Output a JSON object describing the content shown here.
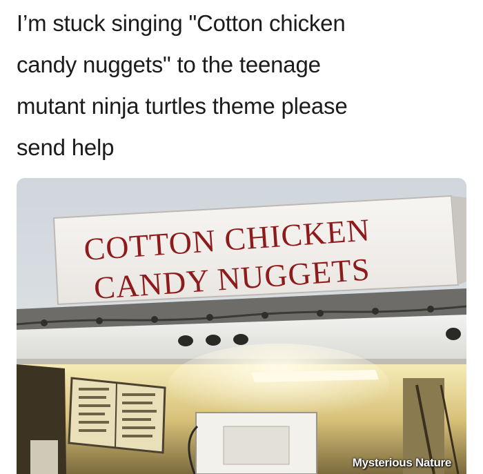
{
  "post": {
    "caption_lines": [
      "I’m stuck singing \"Cotton chicken",
      "candy nuggets\" to the teenage",
      "mutant ninja turtles theme please",
      "send help"
    ]
  },
  "photo": {
    "sign_line_1": "COTTON CHICKEN",
    "sign_line_2": "CANDY NUGGETS",
    "watermark": "Mysterious Nature",
    "colors": {
      "sky": "#d9dee3",
      "sign_face": "#f4f1ed",
      "sign_text": "#8e1b1b",
      "truck_interior": "#e9d690"
    }
  }
}
